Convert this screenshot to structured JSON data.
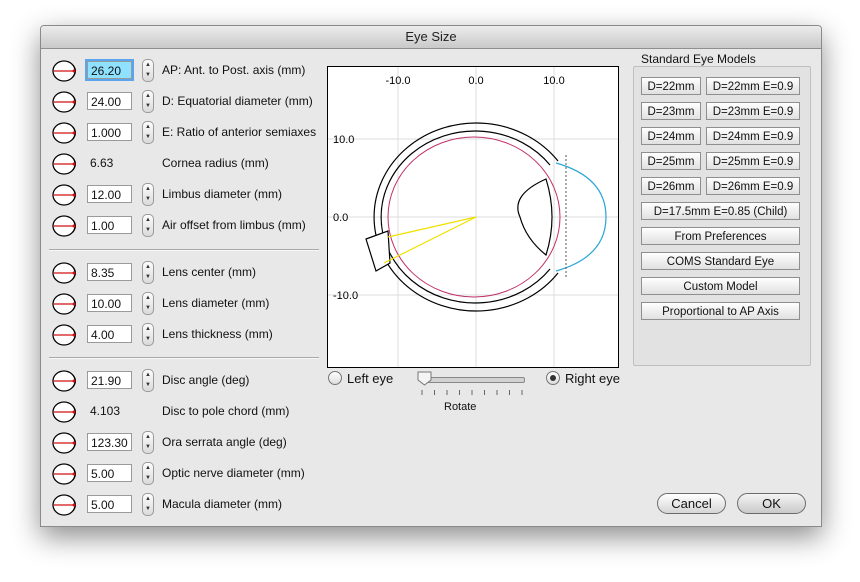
{
  "window": {
    "title": "Eye Size"
  },
  "fields": [
    {
      "icon": "ap-axis-icon",
      "value": "26.20",
      "label": "AP: Ant. to Post. axis (mm)",
      "focused": true,
      "editable": true
    },
    {
      "icon": "equatorial-diameter-icon",
      "value": "24.00",
      "label": "D: Equatorial diameter (mm)",
      "editable": true
    },
    {
      "icon": "semiaxes-ratio-icon",
      "value": "1.000",
      "label": "E: Ratio of anterior semiaxes",
      "editable": true
    },
    {
      "icon": "cornea-radius-icon",
      "value": "6.63",
      "label": "Cornea radius (mm)",
      "editable": false
    },
    {
      "icon": "limbus-diameter-icon",
      "value": "12.00",
      "label": "Limbus diameter (mm)",
      "editable": true
    },
    {
      "icon": "air-offset-icon",
      "value": "1.00",
      "label": "Air offset from limbus (mm)",
      "editable": true
    },
    {
      "icon": "lens-center-icon",
      "value": "8.35",
      "label": "Lens center (mm)",
      "editable": true
    },
    {
      "icon": "lens-diameter-icon",
      "value": "10.00",
      "label": "Lens diameter (mm)",
      "editable": true
    },
    {
      "icon": "lens-thickness-icon",
      "value": "4.00",
      "label": "Lens thickness (mm)",
      "editable": true
    },
    {
      "icon": "disc-angle-icon",
      "value": "21.90",
      "label": "Disc angle (deg)",
      "editable": true
    },
    {
      "icon": "disc-chord-icon",
      "value": "4.103",
      "label": "Disc to pole chord (mm)",
      "editable": false
    },
    {
      "icon": "ora-serrata-icon",
      "value": "123.30",
      "label": "Ora serrata angle (deg)",
      "editable": true
    },
    {
      "icon": "optic-nerve-icon",
      "value": "5.00",
      "label": "Optic nerve diameter (mm)",
      "editable": true
    },
    {
      "icon": "macula-diameter-icon",
      "value": "5.00",
      "label": "Macula diameter (mm)",
      "editable": true
    }
  ],
  "plot": {
    "x_ticks": [
      "-10.0",
      "0.0",
      "10.0"
    ],
    "y_ticks": [
      "10.0",
      "0.0",
      "-10.0"
    ],
    "colors": {
      "sclera": "#000000",
      "retina": "#c0306a",
      "cornea": "#2aa6d8",
      "rays": "#f0e000",
      "grid": "#dcdcdc"
    }
  },
  "eye_selection": {
    "left_label": "Left eye",
    "right_label": "Right eye",
    "selected": "right"
  },
  "rotate": {
    "label": "Rotate",
    "value_fraction": 0.0
  },
  "standard_models": {
    "title": "Standard Eye Models",
    "pairs": [
      [
        "D=22mm",
        "D=22mm E=0.9"
      ],
      [
        "D=23mm",
        "D=23mm E=0.9"
      ],
      [
        "D=24mm",
        "D=24mm E=0.9"
      ],
      [
        "D=25mm",
        "D=25mm E=0.9"
      ],
      [
        "D=26mm",
        "D=26mm E=0.9"
      ]
    ],
    "wide": [
      "D=17.5mm E=0.85 (Child)",
      "From Preferences",
      "COMS Standard Eye",
      "Custom Model",
      "Proportional to AP Axis"
    ]
  },
  "actions": {
    "cancel": "Cancel",
    "ok": "OK"
  }
}
